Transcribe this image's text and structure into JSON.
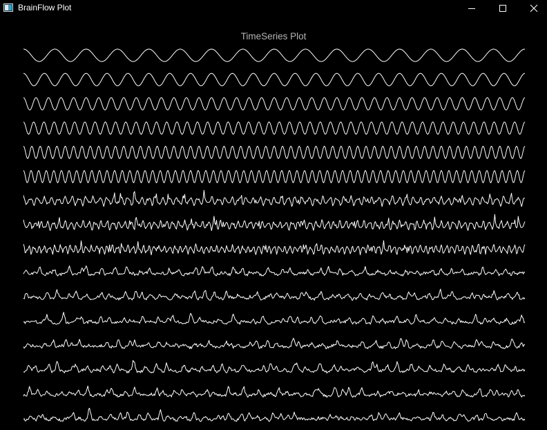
{
  "window": {
    "title": "BrainFlow Plot",
    "icons": {
      "app": "app-icon",
      "minimize": "minimize-icon",
      "maximize": "maximize-icon",
      "close": "close-icon"
    }
  },
  "colors": {
    "background": "#000000",
    "trace": "#ffffff",
    "title": "#b4b4b4"
  },
  "chart_data": {
    "type": "line",
    "title": "TimeSeries Plot",
    "axes_visible": false,
    "grid": false,
    "layout": "stacked",
    "channels": [
      {
        "shape": "sine",
        "cycles": 16
      },
      {
        "shape": "sine",
        "cycles": 24
      },
      {
        "shape": "sine",
        "cycles": 40
      },
      {
        "shape": "sine",
        "cycles": 49
      },
      {
        "shape": "sine",
        "cycles": 60
      },
      {
        "shape": "sine",
        "cycles": 66
      },
      {
        "shape": "noisy-oscillation",
        "cycles": 72
      },
      {
        "shape": "noisy-oscillation",
        "cycles": 84
      },
      {
        "shape": "noisy-oscillation",
        "cycles": 96
      },
      {
        "shape": "spiky",
        "cycles": 40
      },
      {
        "shape": "spiky",
        "cycles": 48
      },
      {
        "shape": "spiky",
        "cycles": 44
      },
      {
        "shape": "spiky",
        "cycles": 46
      },
      {
        "shape": "spiky",
        "cycles": 50
      },
      {
        "shape": "spiky",
        "cycles": 48
      },
      {
        "shape": "spiky",
        "cycles": 54
      }
    ]
  }
}
